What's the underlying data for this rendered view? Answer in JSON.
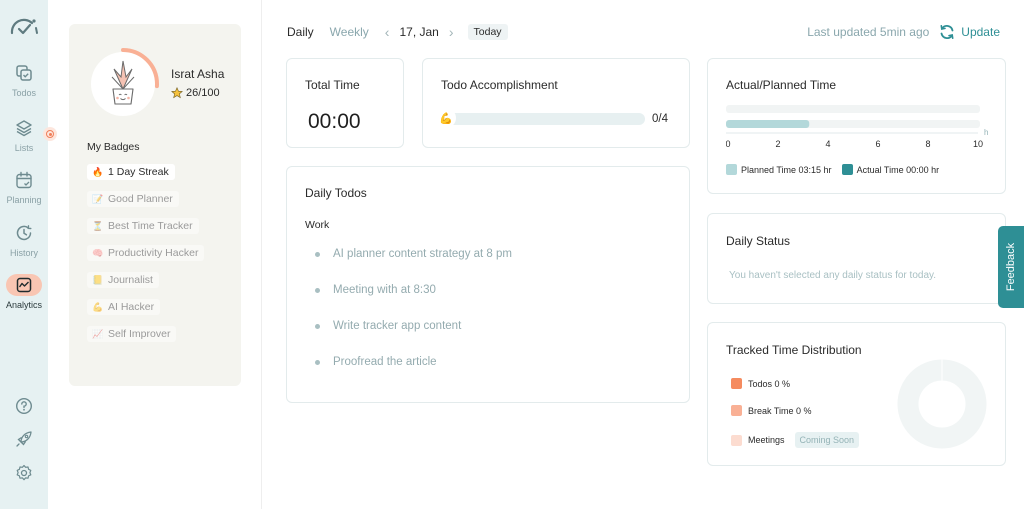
{
  "nav": {
    "logo": "gauge-logo",
    "items": [
      {
        "label": "Todos",
        "icon": "todos-icon"
      },
      {
        "label": "Lists",
        "icon": "layers-icon"
      },
      {
        "label": "Planning",
        "icon": "calendar-icon"
      },
      {
        "label": "History",
        "icon": "history-icon"
      },
      {
        "label": "Analytics",
        "icon": "analytics-icon",
        "active": true
      }
    ],
    "bottom": [
      {
        "icon": "help-icon"
      },
      {
        "icon": "rocket-icon"
      },
      {
        "icon": "settings-icon"
      }
    ]
  },
  "profile": {
    "name": "Israt Asha",
    "score": "26/100",
    "score_progress": 0.26,
    "badges_title": "My Badges",
    "badges": [
      {
        "label": "1 Day Streak",
        "icon": "🔥",
        "earned": true
      },
      {
        "label": "Good Planner",
        "icon": "📝",
        "earned": false
      },
      {
        "label": "Best Time Tracker",
        "icon": "⏳",
        "earned": false
      },
      {
        "label": "Productivity Hacker",
        "icon": "🧠",
        "earned": false
      },
      {
        "label": "Journalist",
        "icon": "📒",
        "earned": false
      },
      {
        "label": "AI Hacker",
        "icon": "💪",
        "earned": false
      },
      {
        "label": "Self Improver",
        "icon": "📈",
        "earned": false
      }
    ]
  },
  "topbar": {
    "tabs": [
      {
        "label": "Daily",
        "active": true
      },
      {
        "label": "Weekly",
        "active": false
      }
    ],
    "date": "17, Jan",
    "today_label": "Today",
    "last_updated": "Last updated 5min ago",
    "update_label": "Update"
  },
  "total_time": {
    "title": "Total Time",
    "value": "00:00"
  },
  "todo_accomplishment": {
    "title": "Todo Accomplishment",
    "done": 0,
    "total": 4,
    "count_label": "0/4",
    "icon": "💪"
  },
  "daily_todos": {
    "title": "Daily Todos",
    "group": "Work",
    "items": [
      "AI planner content strategy at 8 pm",
      "Meeting with at 8:30",
      "Write tracker app content",
      "Proofread the article"
    ]
  },
  "actual_planned": {
    "title": "Actual/Planned Time",
    "unit": "hr",
    "legend_planned": "Planned Time 03:15 hr",
    "legend_actual": "Actual Time 00:00 hr"
  },
  "daily_status": {
    "title": "Daily Status",
    "message": "You haven't selected any daily status for today."
  },
  "tracked_time": {
    "title": "Tracked Time Distribution",
    "rows": [
      {
        "label": "Todos 0 %",
        "color": "#f58b5f"
      },
      {
        "label": "Break Time 0 %",
        "color": "#f9b095"
      },
      {
        "label": "Meetings",
        "color": "#fcdcd0",
        "badge": "Coming Soon"
      }
    ]
  },
  "feedback_label": "Feedback",
  "colors": {
    "accent": "#2e8f95",
    "planned": "#b3d8da",
    "actual": "#2e8f95",
    "orange": "#f58b5f",
    "rail_bg": "#e6f1f2"
  },
  "chart_data": {
    "type": "bar",
    "orientation": "horizontal",
    "title": "Actual/Planned Time",
    "categories": [
      "Actual Time",
      "Planned Time"
    ],
    "series": [
      {
        "name": "Actual Time",
        "values": [
          0,
          null
        ]
      },
      {
        "name": "Planned Time",
        "values": [
          null,
          3.25
        ]
      }
    ],
    "values": [
      0,
      3.25
    ],
    "xlabel": "hr",
    "xlim": [
      0,
      10
    ],
    "xticks": [
      0,
      2,
      4,
      6,
      8,
      10
    ],
    "legend": [
      "Planned Time 03:15 hr",
      "Actual Time 00:00 hr"
    ],
    "legend_position": "bottom"
  }
}
